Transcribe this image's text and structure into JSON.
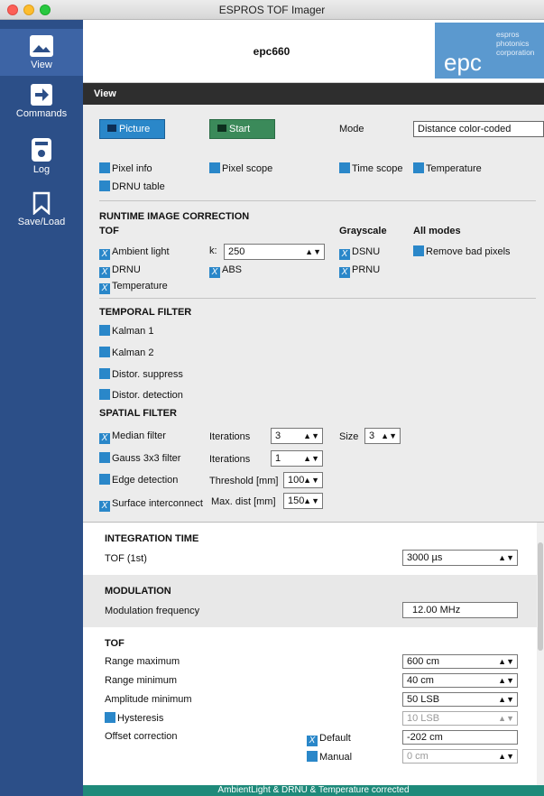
{
  "window": {
    "title": "ESPROS TOF Imager"
  },
  "sidebar": {
    "items": [
      {
        "label": "View",
        "icon": "image-icon"
      },
      {
        "label": "Commands",
        "icon": "arrow-right-icon"
      },
      {
        "label": "Log",
        "icon": "document-icon"
      },
      {
        "label": "Save/Load",
        "icon": "bookmark-icon"
      }
    ]
  },
  "header": {
    "device": "epc660",
    "logo_text": "epc",
    "logo_sub1": "espros",
    "logo_sub2": "photonics",
    "logo_sub3": "corporation"
  },
  "viewbar": {
    "title": "View"
  },
  "controls": {
    "picture_label": "Picture",
    "start_label": "Start",
    "mode_label": "Mode",
    "mode_value": "Distance color-coded",
    "checks": {
      "pixel_info": "Pixel info",
      "pixel_scope": "Pixel scope",
      "time_scope": "Time scope",
      "temperature": "Temperature",
      "drnu_table": "DRNU table"
    }
  },
  "runtime": {
    "title": "RUNTIME IMAGE CORRECTION",
    "tof": "TOF",
    "grayscale": "Grayscale",
    "all_modes": "All modes",
    "ambient": "Ambient light",
    "k_label": "k:",
    "k_value": "250",
    "dsnu": "DSNU",
    "remove_bad": "Remove bad pixels",
    "drnu": "DRNU",
    "abs": "ABS",
    "prnu": "PRNU",
    "temperature": "Temperature",
    "check_mark": "X"
  },
  "temporal": {
    "title": "TEMPORAL FILTER",
    "kalman1": "Kalman 1",
    "kalman2": "Kalman 2",
    "distor_suppress": "Distor. suppress",
    "distor_detect": "Distor. detection"
  },
  "spatial": {
    "title": "SPATIAL FILTER",
    "median": "Median  filter",
    "gauss": "Gauss 3x3 filter",
    "edge": "Edge detection",
    "surface": "Surface interconnect",
    "iterations": "Iterations",
    "iter_median": "3",
    "iter_gauss": "1",
    "size_label": "Size",
    "size_value": "3",
    "threshold": "Threshold [mm]",
    "threshold_value": "100",
    "maxdist": "Max. dist  [mm]",
    "maxdist_value": "150"
  },
  "integration": {
    "title": "INTEGRATION TIME",
    "tof1": "TOF (1st)",
    "tof1_value": "3000 µs"
  },
  "modulation": {
    "title": "MODULATION",
    "freq_label": "Modulation frequency",
    "freq_value": "12.00 MHz"
  },
  "tofsec": {
    "title": "TOF",
    "range_max": "Range maximum",
    "range_max_value": "600 cm",
    "range_min": "Range minimum",
    "range_min_value": "40 cm",
    "amp_min": "Amplitude minimum",
    "amp_min_value": "50 LSB",
    "hysteresis": "Hysteresis",
    "hysteresis_value": "10 LSB",
    "offset": "Offset correction",
    "default": "Default",
    "default_value": "-202 cm",
    "manual": "Manual",
    "manual_value": "0 cm"
  },
  "status": {
    "text": "AmbientLight & DRNU & Temperature corrected"
  },
  "colors": {
    "sidebar": "#2c4f88",
    "accent": "#2a87c9",
    "start": "#3b8a5a",
    "status": "#1e8a7a"
  }
}
